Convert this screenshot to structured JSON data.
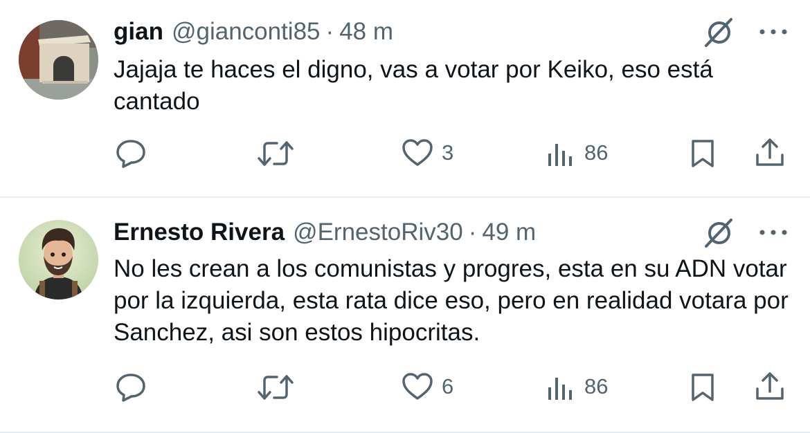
{
  "tweets": [
    {
      "avatar_icon": "doghouse-avatar",
      "name": "gian",
      "handle": "@gianconti85",
      "separator": "·",
      "time": "48 m",
      "text": "Jajaja te haces el digno, vas a votar por Keiko, eso está cantado",
      "likes": "3",
      "views": "86"
    },
    {
      "avatar_icon": "cartoon-man-avatar",
      "name": "Ernesto Rivera",
      "handle": "@ErnestoRiv30",
      "separator": "·",
      "time": "49 m",
      "text": "No les crean a los comunistas y progres, esta en su ADN votar por la izquierda, esta rata dice eso, pero en realidad votara por Sanchez, asi son estos hipocritas.",
      "likes": "6",
      "views": "86"
    }
  ],
  "icons": [
    "grok-icon",
    "more-icon",
    "reply-icon",
    "retweet-icon",
    "like-icon",
    "views-icon",
    "bookmark-icon",
    "share-icon"
  ],
  "colors": {
    "text": "#0f1419",
    "secondary": "#536471",
    "divider": "#e6ecf0"
  }
}
